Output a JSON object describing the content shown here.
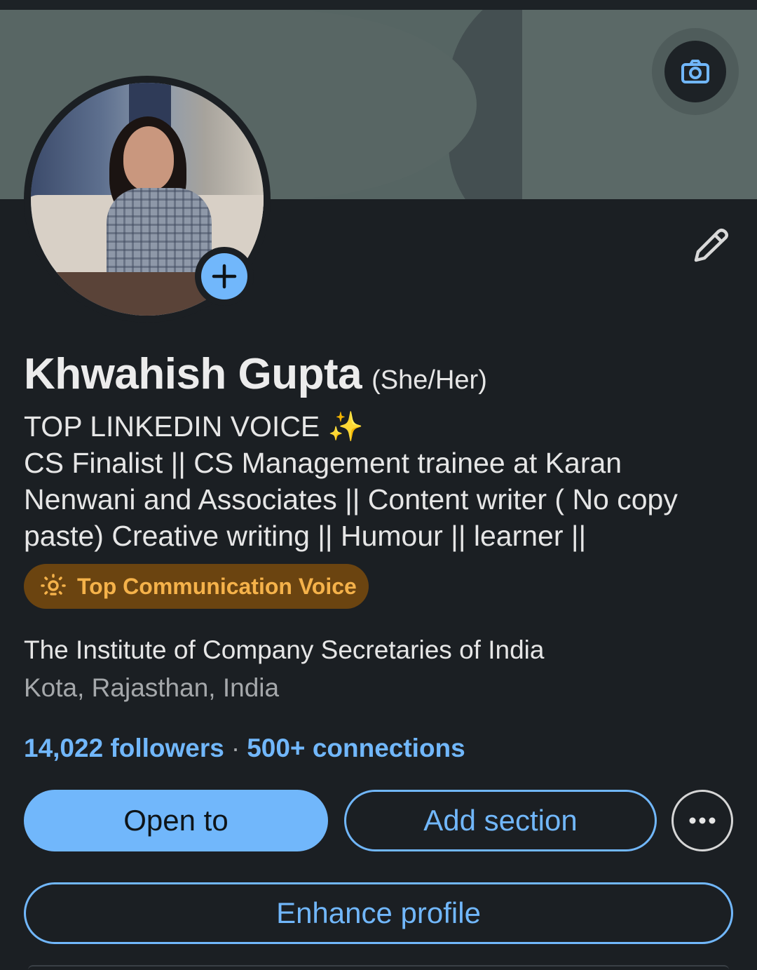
{
  "profile": {
    "name": "Khwahish Gupta",
    "pronouns": "(She/Her)",
    "headline_line1": "TOP LINKEDIN VOICE ✨",
    "headline_rest": "CS Finalist || CS Management trainee at Karan Nenwani and Associates || Content writer ( No copy paste) Creative writing || Humour || learner ||",
    "badge": "Top Communication Voice",
    "organization": "The Institute of Company Secretaries of India",
    "location": "Kota, Rajasthan, India",
    "followers": "14,022 followers",
    "separator": "·",
    "connections": "500+ connections"
  },
  "actions": {
    "open_to": "Open to",
    "add_section": "Add section",
    "enhance_profile": "Enhance profile"
  },
  "icons": {
    "camera": "camera-icon",
    "add_photo": "plus-icon",
    "edit": "pencil-icon",
    "badge": "lightbulb-icon",
    "more": "ellipsis-icon"
  },
  "colors": {
    "background": "#1b1f23",
    "accent": "#71b7fb",
    "badge_bg": "#6b4410",
    "badge_text": "#f5b24a"
  }
}
